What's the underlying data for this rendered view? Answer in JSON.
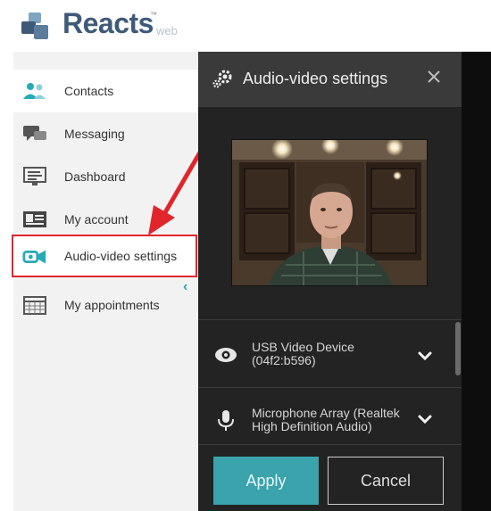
{
  "brand": {
    "name": "Reacts",
    "tm": "™",
    "suffix": "web",
    "accent": "#3aa3ac",
    "logo_color": "#3f5a78",
    "highlight_color": "#e0262b"
  },
  "sidebar": {
    "items": [
      {
        "label": "Contacts",
        "icon": "contacts-icon",
        "active": true
      },
      {
        "label": "Messaging",
        "icon": "messaging-icon",
        "active": false
      },
      {
        "label": "Dashboard",
        "icon": "dashboard-icon",
        "active": false
      },
      {
        "label": "My account",
        "icon": "account-card-icon",
        "active": false
      },
      {
        "label": "Audio-video settings",
        "icon": "camera-icon",
        "active": false,
        "highlighted": true
      },
      {
        "label": "My appointments",
        "icon": "calendar-icon",
        "active": false
      }
    ],
    "collapse_glyph": "‹"
  },
  "panel": {
    "title": "Audio-video settings",
    "close_glyph": "×",
    "video_device": {
      "line1": "USB Video Device",
      "line2": "(04f2:b596)",
      "icon": "webcam-icon"
    },
    "audio_device": {
      "line1": "Microphone Array (Realtek",
      "line2": "High Definition Audio)",
      "icon": "microphone-icon"
    },
    "apply_label": "Apply",
    "cancel_label": "Cancel"
  }
}
